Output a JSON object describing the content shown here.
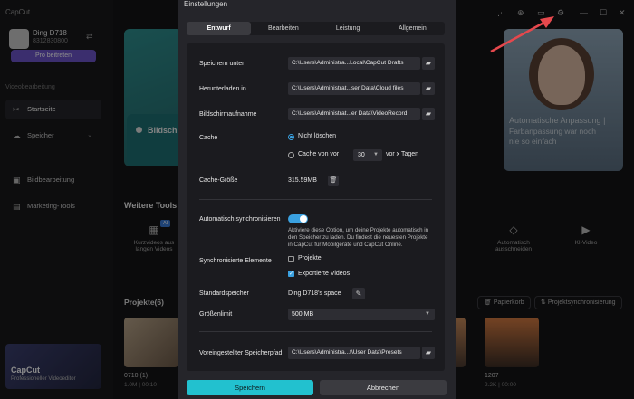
{
  "app": {
    "brand": "CapCut",
    "profile": {
      "name": "Ding D718",
      "id": "8312830800"
    },
    "pro_button": "Pro beitreten",
    "section_video": "Videobearbeitung",
    "nav": [
      {
        "label": "Startseite",
        "icon": "home-icon"
      },
      {
        "label": "Speicher",
        "icon": "cloud-icon"
      },
      {
        "label": "Bildbearbeitung",
        "icon": "image-icon"
      },
      {
        "label": "Marketing-Tools",
        "icon": "marketing-icon"
      }
    ],
    "promo": {
      "title": "CapCut",
      "subtitle": "Professioneller Videoeditor"
    },
    "card_bs": "Bildsch",
    "banner_right": {
      "line1": "Automatische Anpassung |",
      "line2": "Farbanpassung war noch",
      "line3": "nie so einfach"
    },
    "weitere_tools": "Weitere Tools",
    "tools": [
      {
        "label1": "Kurzvideos aus",
        "label2": "langen Videos",
        "badge": "AI"
      },
      {
        "label1": "Automatisch",
        "label2": "ausschneiden"
      },
      {
        "label1": "KI-Video",
        "label2": ""
      }
    ],
    "projects_title": "Projekte(6)",
    "papierkorb": "Papierkorb",
    "projektsync": "Projektsynchronisierung",
    "thumbs": [
      {
        "name": "0710 (1)",
        "meta": "1.0M | 00:10"
      },
      {
        "name": "1207",
        "meta": "2.2K | 00:00"
      }
    ]
  },
  "dialog": {
    "title": "Einstellungen",
    "tabs": [
      "Entwurf",
      "Bearbeiten",
      "Leistung",
      "Allgemein"
    ],
    "rows": {
      "speichern_label": "Speichern unter",
      "speichern_path": "C:\\Users\\Administra...Local\\CapCut Drafts",
      "herunterladen_label": "Herunterladen in",
      "herunterladen_path": "C:\\Users\\Administrat...ser Data\\Cloud files",
      "screenshot_label": "Bildschirmaufnahme",
      "screenshot_path": "C:\\Users\\Administrat...er Data\\VideoRecord",
      "cache_label": "Cache",
      "cache_opt1": "Nicht löschen",
      "cache_opt2": "Cache von vor",
      "cache_days": "30",
      "cache_suffix": "vor x Tagen",
      "cache_size_label": "Cache-Größe",
      "cache_size_value": "315.59MB",
      "autosync_label": "Automatisch synchronisieren",
      "autosync_desc": "Aktiviere diese Option, um deine Projekte automatisch in den Speicher zu laden. Du findest die neuesten Projekte in CapCut für Mobilgeräte und CapCut Online.",
      "sync_elements_label": "Synchronisierte Elemente",
      "sync_projects": "Projekte",
      "sync_exports": "Exportierte Videos",
      "default_storage_label": "Standardspeicher",
      "default_storage_value": "Ding D718's space",
      "size_limit_label": "Größenlimit",
      "size_limit_value": "500 MB",
      "preset_label": "Voreingestellter Speicherpfad",
      "preset_path": "C:\\Users\\Administra...t\\User Data\\Presets"
    },
    "save": "Speichern",
    "cancel": "Abbrechen"
  },
  "colors": {
    "accent": "#22c1cf",
    "toggle": "#3aa1e0",
    "arrow": "#e5484d"
  }
}
